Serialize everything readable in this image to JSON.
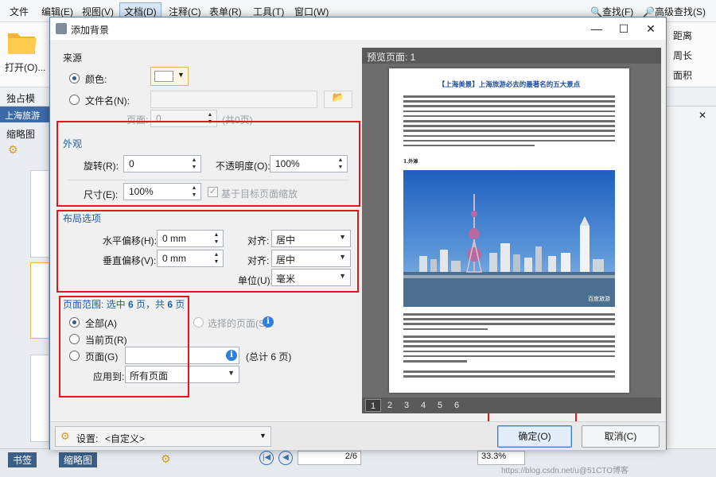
{
  "app": {
    "menu": [
      "文件",
      "编辑(E)",
      "视图(V)",
      "文档(D)",
      "注释(C)",
      "表单(R)",
      "工具(T)",
      "窗口(W)"
    ],
    "search": {
      "find": "查找(F)",
      "advanced_find": "高级查找(S)"
    },
    "ribbon": {
      "open_label": "打开(O)...",
      "exclusive_label": "独占模",
      "right_items": [
        "距离",
        "周长",
        "面积"
      ]
    },
    "doc_tab": "上海旅游",
    "sidebar_title": "缩略图",
    "bottom_tabs": [
      "书签",
      "缩略图"
    ],
    "status": {
      "page_indicator": "2/6",
      "zoom": "33.3%",
      "watermark": "https://blog.csdn.net/u@51CTO博客"
    }
  },
  "dialog": {
    "title": "添加背景",
    "source": {
      "heading": "来源",
      "color_label": "颜色:",
      "color_value": "#ffffff",
      "file_label": "文件名(N):",
      "page_label": "页面:",
      "page_value": "0",
      "page_total": "(共0页)"
    },
    "appearance": {
      "heading": "外观",
      "rotation_label": "旋转(R):",
      "rotation_value": "0",
      "opacity_label": "不透明度(O):",
      "opacity_value": "100%",
      "size_label": "尺寸(E):",
      "size_value": "100%",
      "scale_label": "基于目标页面缩放"
    },
    "layout": {
      "heading": "布局选项",
      "h_offset_label": "水平偏移(H):",
      "h_offset_value": "0 mm",
      "v_offset_label": "垂直偏移(V):",
      "v_offset_value": "0 mm",
      "align_label_1": "对齐:",
      "align_value_1": "居中",
      "align_label_2": "对齐:",
      "align_value_2": "居中",
      "unit_label": "单位(U):",
      "unit_value": "毫米"
    },
    "range": {
      "heading_prefix": "页面范围: 选中 ",
      "selected_count": "6",
      "heading_mid": " 页，共 ",
      "total_count": "6",
      "heading_suffix": " 页",
      "all_label": "全部(A)",
      "current_label": "当前页(R)",
      "pages_label": "页面(G)",
      "selected_pages_label": "选择的页面(S)",
      "pages_total": "(总计 6 页)",
      "apply_label": "应用到:",
      "apply_value": "所有页面"
    },
    "preview": {
      "heading": "预览页面: 1",
      "page_title": "【上海美景】上海旅游必去的最著名的五大景点",
      "section_label": "1.外滩",
      "photo_caption": "百度旅游",
      "page_tabs": [
        "1",
        "2",
        "3",
        "4",
        "5",
        "6"
      ]
    },
    "settings": {
      "label": "设置:",
      "value": "<自定义>"
    },
    "ok_label": "确定(O)",
    "cancel_label": "取消(C)"
  }
}
